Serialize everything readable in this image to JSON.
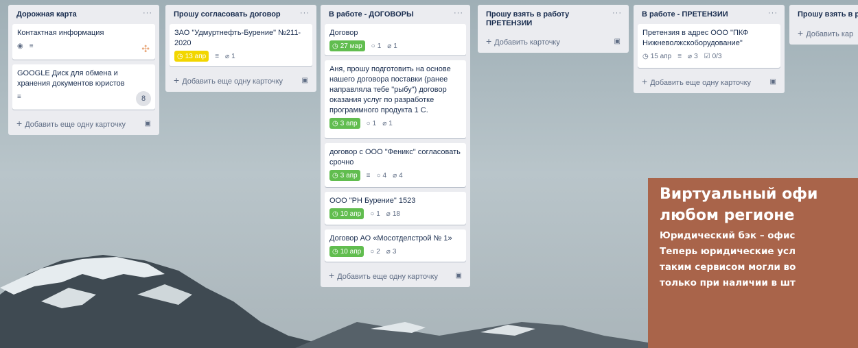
{
  "lists": [
    {
      "title": "Дорожная карта",
      "menu": "···",
      "cards": [
        {
          "title": "Контактная информация",
          "badges": [
            "eye-icon",
            "description-icon"
          ]
        },
        {
          "title": "GOOGLE Диск для обмена и хранения документов юристов",
          "badges": [
            "description-icon"
          ],
          "avatar": "8"
        }
      ],
      "add_label": "Добавить еще одну карточку"
    },
    {
      "title": "Прошу согласовать договор",
      "menu": "···",
      "cards": [
        {
          "title": "ЗАО \"Удмуртнефть-Бурение\" №211-2020",
          "due": "13 апр",
          "due_color": "#f2d600",
          "attachments": "1"
        }
      ],
      "add_label": "Добавить еще одну карточку"
    },
    {
      "title": "В работе - ДОГОВОРЫ",
      "menu": "···",
      "cards": [
        {
          "title": "Договор",
          "due": "27 мар",
          "comments": "1",
          "attachments": "1"
        },
        {
          "title": "Аня, прошу подготовить на основе нашего договора поставки (ранее направляла тебе \"рыбу\") договор оказания услуг по разработке программного продукта 1 С.",
          "due": "3 апр",
          "comments": "1",
          "attachments": "1"
        },
        {
          "title": "договор с ООО \"Феникс\" согласовать срочно",
          "due": "3 апр",
          "comments": "4",
          "attachments": "4"
        },
        {
          "title": "ООО \"РН Бурение\" 1523",
          "due": "10 апр",
          "comments": "1",
          "attachments": "18"
        },
        {
          "title": "Договор АО «Мосотделстрой № 1»",
          "due": "10 апр",
          "comments": "2",
          "attachments": "3"
        }
      ],
      "add_label": "Добавить еще одну карточку"
    },
    {
      "title": "Прошу взять в работу ПРЕТЕНЗИИ",
      "menu": "···",
      "cards": [],
      "add_label": "Добавить карточку"
    },
    {
      "title": "В работе - ПРЕТЕНЗИИ",
      "menu": "···",
      "cards": [
        {
          "title": "Претензия в адрес ООО \"ПКФ Нижневолжскоборудование\"",
          "due": "15 апр",
          "attachments": "3",
          "checklist": "0/3"
        }
      ],
      "add_label": "Добавить еще одну карточку"
    },
    {
      "title": "Прошу взять в р",
      "menu": "",
      "cards": [],
      "add_label": "Добавить кар"
    }
  ],
  "promo": {
    "title_line1": "Виртуальный офи",
    "title_line2": "любом регионе",
    "lines": [
      "Юридический бэк – офис",
      "Теперь юридические усл",
      "таким сервисом могли во",
      "только при наличии в шт"
    ],
    "background": "#a9644a"
  },
  "colors": {
    "due_green": "#61bd4f",
    "due_yellow": "#f2d600",
    "list_bg": "#ebecf0"
  }
}
